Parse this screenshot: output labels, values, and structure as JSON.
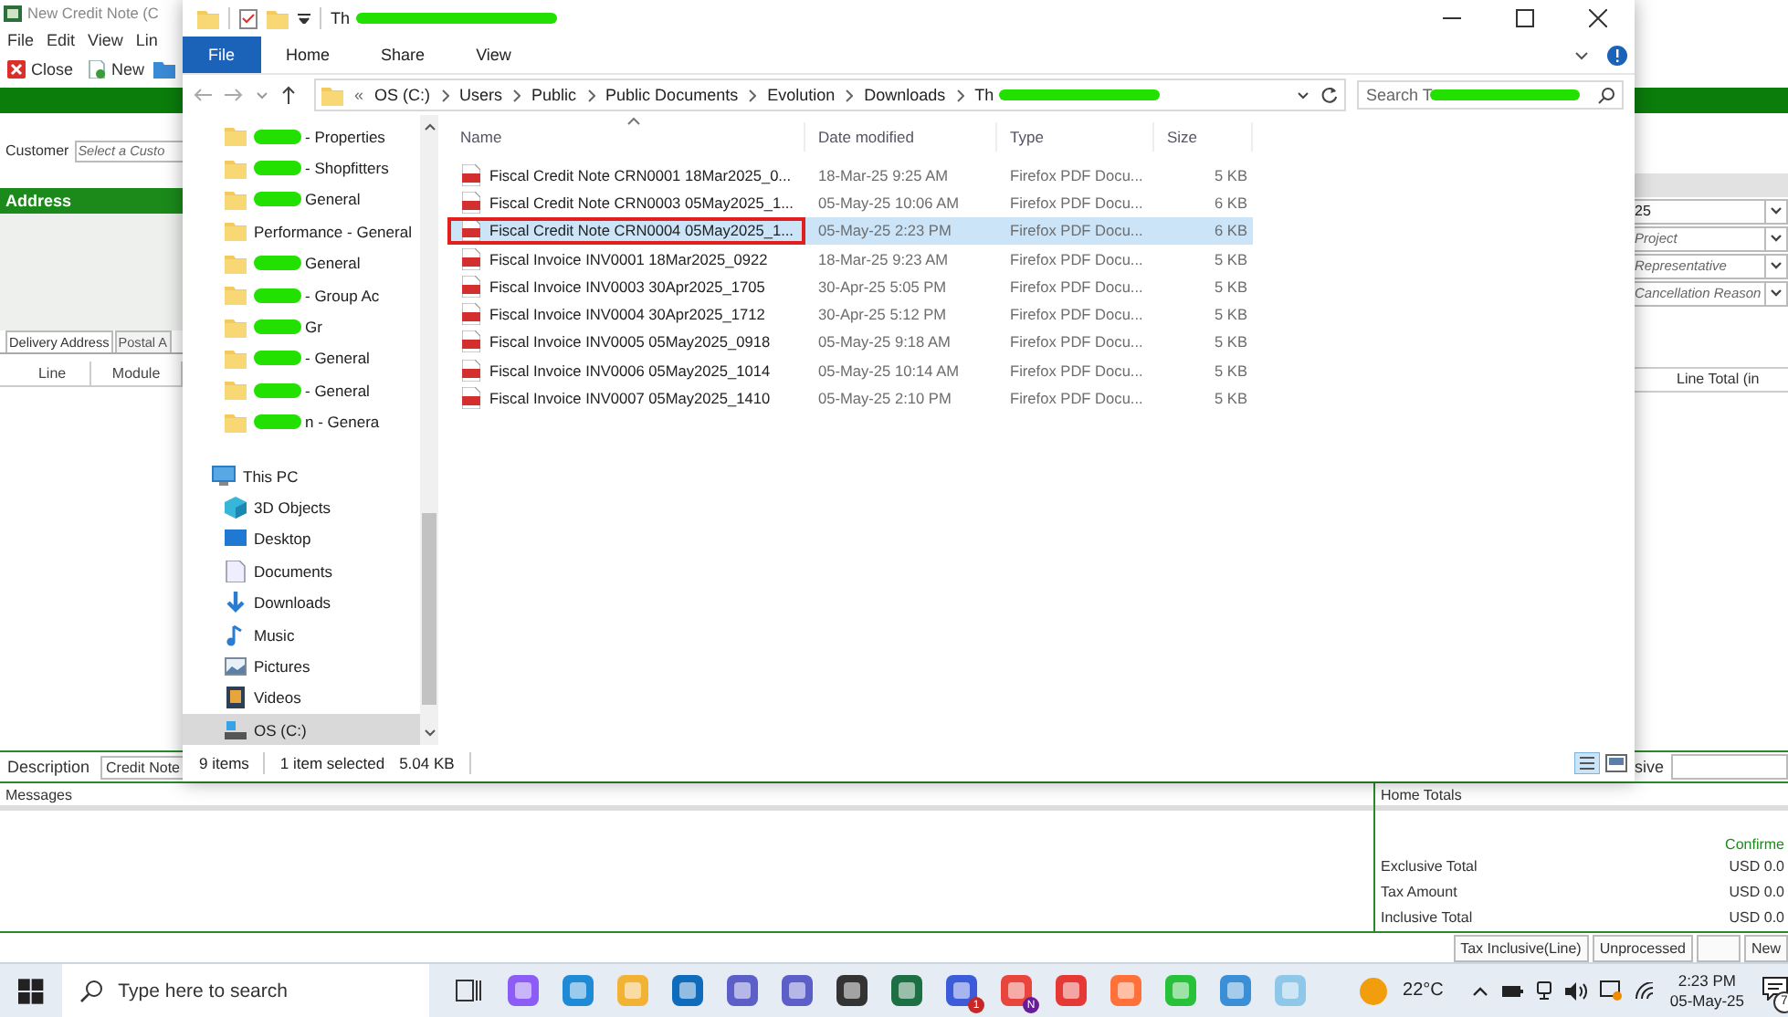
{
  "app": {
    "title": "New Credit Note (C",
    "menu": [
      "File",
      "Edit",
      "View",
      "Lin"
    ],
    "toolbar": [
      "Close",
      "New"
    ],
    "customer": {
      "label": "Customer",
      "placeholder": "Select a Custo"
    },
    "address_header": "Address",
    "tabs": [
      {
        "label": "Delivery Address",
        "selected": true
      },
      {
        "label": "Postal A",
        "selected": false
      }
    ],
    "grid_columns": [
      "Line",
      "Module"
    ],
    "right_fields": [
      {
        "value": "25"
      },
      {
        "placeholder": "Project"
      },
      {
        "placeholder": "Representative"
      },
      {
        "placeholder": "Cancellation Reason"
      }
    ],
    "right_grid_column": "Line Total (in",
    "description": {
      "label": "Description",
      "value": "Credit Note"
    },
    "right_label": "sive",
    "messages": {
      "title": "Messages"
    },
    "totals": {
      "title": "Home Totals",
      "status": "Confirme",
      "rows": [
        {
          "label": "Exclusive Total",
          "value": "USD 0.0"
        },
        {
          "label": "Tax Amount",
          "value": "USD 0.0"
        },
        {
          "label": "Inclusive Total",
          "value": "USD 0.0"
        }
      ]
    },
    "status_bar": [
      {
        "kind": "text",
        "text": "Tax Inclusive(Line)"
      },
      {
        "kind": "text",
        "text": "Unprocessed"
      },
      {
        "kind": "blank"
      },
      {
        "kind": "text",
        "text": "New"
      }
    ]
  },
  "explorer": {
    "title": "Th",
    "title_redacted": true,
    "ribbon_tabs": [
      {
        "label": "File",
        "selected": true
      },
      {
        "label": "Home",
        "selected": false
      },
      {
        "label": "Share",
        "selected": false
      },
      {
        "label": "View",
        "selected": false
      }
    ],
    "breadcrumb_overflow": "«",
    "breadcrumb": [
      "OS (C:)",
      "Users",
      "Public",
      "Public Documents",
      "Evolution",
      "Downloads",
      "Th"
    ],
    "search": {
      "placeholder": "Search T"
    },
    "nav_folders": [
      {
        "label": "- Properties",
        "redacted": true
      },
      {
        "label": "- Shopfitters",
        "redacted": true
      },
      {
        "label": "General",
        "redacted": true
      },
      {
        "label": "Performance - General",
        "redacted": false
      },
      {
        "label": "General",
        "redacted": true
      },
      {
        "label": "- Group Ac",
        "redacted": true
      },
      {
        "label": "Gr",
        "redacted": true
      },
      {
        "label": "- General",
        "redacted": true
      },
      {
        "label": "- General",
        "redacted": true
      },
      {
        "label": "n - Genera",
        "redacted": true
      }
    ],
    "this_pc": {
      "label": "This PC",
      "children": [
        {
          "label": "3D Objects",
          "kind": "cube",
          "selected": false
        },
        {
          "label": "Desktop",
          "kind": "desktop",
          "selected": false
        },
        {
          "label": "Documents",
          "kind": "documents",
          "selected": false
        },
        {
          "label": "Downloads",
          "kind": "downloads",
          "selected": false
        },
        {
          "label": "Music",
          "kind": "music",
          "selected": false
        },
        {
          "label": "Pictures",
          "kind": "pictures",
          "selected": false
        },
        {
          "label": "Videos",
          "kind": "videos",
          "selected": false
        },
        {
          "label": "OS (C:)",
          "kind": "drive",
          "selected": true
        }
      ]
    },
    "columns": [
      "Name",
      "Date modified",
      "Type",
      "Size"
    ],
    "files": [
      {
        "name": "Fiscal Credit Note CRN0001 18Mar2025_0...",
        "date": "18-Mar-25 9:25 AM",
        "type": "Firefox PDF Docu...",
        "size": "5 KB",
        "selected": false,
        "highlighted": false
      },
      {
        "name": "Fiscal Credit Note CRN0003 05May2025_1...",
        "date": "05-May-25 10:06 AM",
        "type": "Firefox PDF Docu...",
        "size": "6 KB",
        "selected": false,
        "highlighted": false
      },
      {
        "name": "Fiscal Credit Note CRN0004 05May2025_1...",
        "date": "05-May-25 2:23 PM",
        "type": "Firefox PDF Docu...",
        "size": "6 KB",
        "selected": true,
        "highlighted": true
      },
      {
        "name": "Fiscal Invoice INV0001 18Mar2025_0922",
        "date": "18-Mar-25 9:23 AM",
        "type": "Firefox PDF Docu...",
        "size": "5 KB",
        "selected": false,
        "highlighted": false
      },
      {
        "name": "Fiscal Invoice INV0003 30Apr2025_1705",
        "date": "30-Apr-25 5:05 PM",
        "type": "Firefox PDF Docu...",
        "size": "5 KB",
        "selected": false,
        "highlighted": false
      },
      {
        "name": "Fiscal Invoice INV0004 30Apr2025_1712",
        "date": "30-Apr-25 5:12 PM",
        "type": "Firefox PDF Docu...",
        "size": "5 KB",
        "selected": false,
        "highlighted": false
      },
      {
        "name": "Fiscal Invoice INV0005 05May2025_0918",
        "date": "05-May-25 9:18 AM",
        "type": "Firefox PDF Docu...",
        "size": "5 KB",
        "selected": false,
        "highlighted": false
      },
      {
        "name": "Fiscal Invoice INV0006 05May2025_1014",
        "date": "05-May-25 10:14 AM",
        "type": "Firefox PDF Docu...",
        "size": "5 KB",
        "selected": false,
        "highlighted": false
      },
      {
        "name": "Fiscal Invoice INV0007 05May2025_1410",
        "date": "05-May-25 2:10 PM",
        "type": "Firefox PDF Docu...",
        "size": "5 KB",
        "selected": false,
        "highlighted": false
      }
    ],
    "status": {
      "count": "9 items",
      "selection": "1 item selected",
      "size": "5.04 KB"
    }
  },
  "taskbar": {
    "search_placeholder": "Type here to search",
    "apps": [
      {
        "kind": "task_view"
      },
      {
        "kind": "app"
      },
      {
        "kind": "app"
      },
      {
        "kind": "app"
      },
      {
        "kind": "app"
      },
      {
        "kind": "app"
      },
      {
        "kind": "app"
      },
      {
        "kind": "app"
      },
      {
        "kind": "app"
      },
      {
        "kind": "app",
        "badge": "1"
      },
      {
        "kind": "app",
        "badge": "N"
      },
      {
        "kind": "app"
      },
      {
        "kind": "app"
      },
      {
        "kind": "app"
      },
      {
        "kind": "app"
      },
      {
        "kind": "app"
      }
    ],
    "weather": "22°C",
    "time": "2:23 PM",
    "date": "05-May-25",
    "notifications": "7"
  }
}
